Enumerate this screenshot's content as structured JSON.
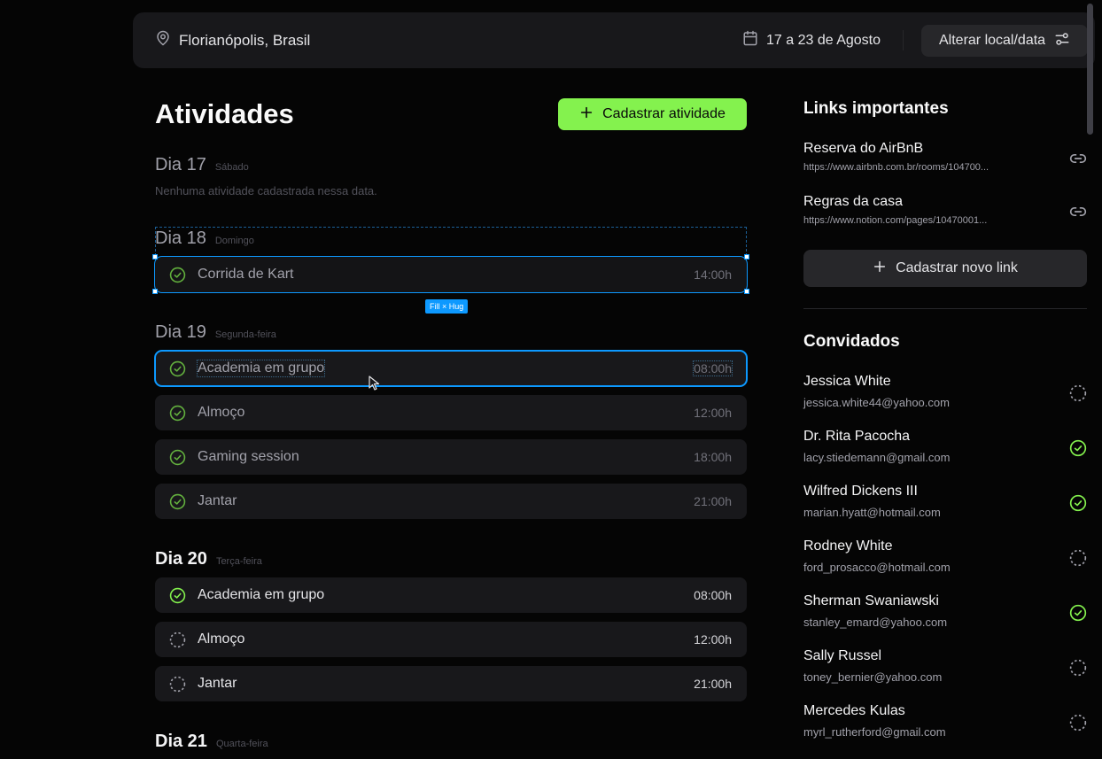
{
  "header": {
    "location": "Florianópolis, Brasil",
    "dates": "17 a 23 de Agosto",
    "change_button": "Alterar local/data"
  },
  "activities": {
    "title": "Atividades",
    "add_button": "Cadastrar atividade",
    "empty_message": "Nenhuma atividade cadastrada nessa data.",
    "days": [
      {
        "label": "Dia 17",
        "weekday": "Sábado",
        "items": []
      },
      {
        "label": "Dia 18",
        "weekday": "Domingo",
        "items": [
          {
            "name": "Corrida de Kart",
            "time": "14:00h",
            "done": true
          }
        ]
      },
      {
        "label": "Dia 19",
        "weekday": "Segunda-feira",
        "items": [
          {
            "name": "Academia em grupo",
            "time": "08:00h",
            "done": true
          },
          {
            "name": "Almoço",
            "time": "12:00h",
            "done": true
          },
          {
            "name": "Gaming session",
            "time": "18:00h",
            "done": true
          },
          {
            "name": "Jantar",
            "time": "21:00h",
            "done": true
          }
        ]
      },
      {
        "label": "Dia 20",
        "weekday": "Terça-feira",
        "items": [
          {
            "name": "Academia em grupo",
            "time": "08:00h",
            "done": true
          },
          {
            "name": "Almoço",
            "time": "12:00h",
            "done": false
          },
          {
            "name": "Jantar",
            "time": "21:00h",
            "done": false
          }
        ]
      },
      {
        "label": "Dia 21",
        "weekday": "Quarta-feira",
        "items": []
      }
    ]
  },
  "selection": {
    "size_tag": "Fill × Hug"
  },
  "links": {
    "title": "Links importantes",
    "items": [
      {
        "title": "Reserva do AirBnB",
        "url": "https://www.airbnb.com.br/rooms/104700..."
      },
      {
        "title": "Regras da casa",
        "url": "https://www.notion.com/pages/10470001..."
      }
    ],
    "add_button": "Cadastrar novo link"
  },
  "guests": {
    "title": "Convidados",
    "items": [
      {
        "name": "Jessica White",
        "email": "jessica.white44@yahoo.com",
        "confirmed": false
      },
      {
        "name": "Dr. Rita Pacocha",
        "email": "lacy.stiedemann@gmail.com",
        "confirmed": true
      },
      {
        "name": "Wilfred Dickens III",
        "email": "marian.hyatt@hotmail.com",
        "confirmed": true
      },
      {
        "name": "Rodney White",
        "email": "ford_prosacco@hotmail.com",
        "confirmed": false
      },
      {
        "name": "Sherman Swaniawski",
        "email": "stanley_emard@yahoo.com",
        "confirmed": true
      },
      {
        "name": "Sally Russel",
        "email": "toney_bernier@yahoo.com",
        "confirmed": false
      },
      {
        "name": "Mercedes Kulas",
        "email": "myrl_rutherford@gmail.com",
        "confirmed": false
      }
    ]
  },
  "colors": {
    "accent": "#84f24e",
    "selection": "#0d99ff",
    "surface": "#18181b",
    "background": "#050505"
  },
  "icons": {
    "location": "map-pin-icon",
    "calendar": "calendar-icon",
    "settings": "sliders-icon",
    "plus": "plus-icon",
    "link": "link-icon",
    "check": "check-circle-icon",
    "pending": "dashed-circle-icon"
  }
}
